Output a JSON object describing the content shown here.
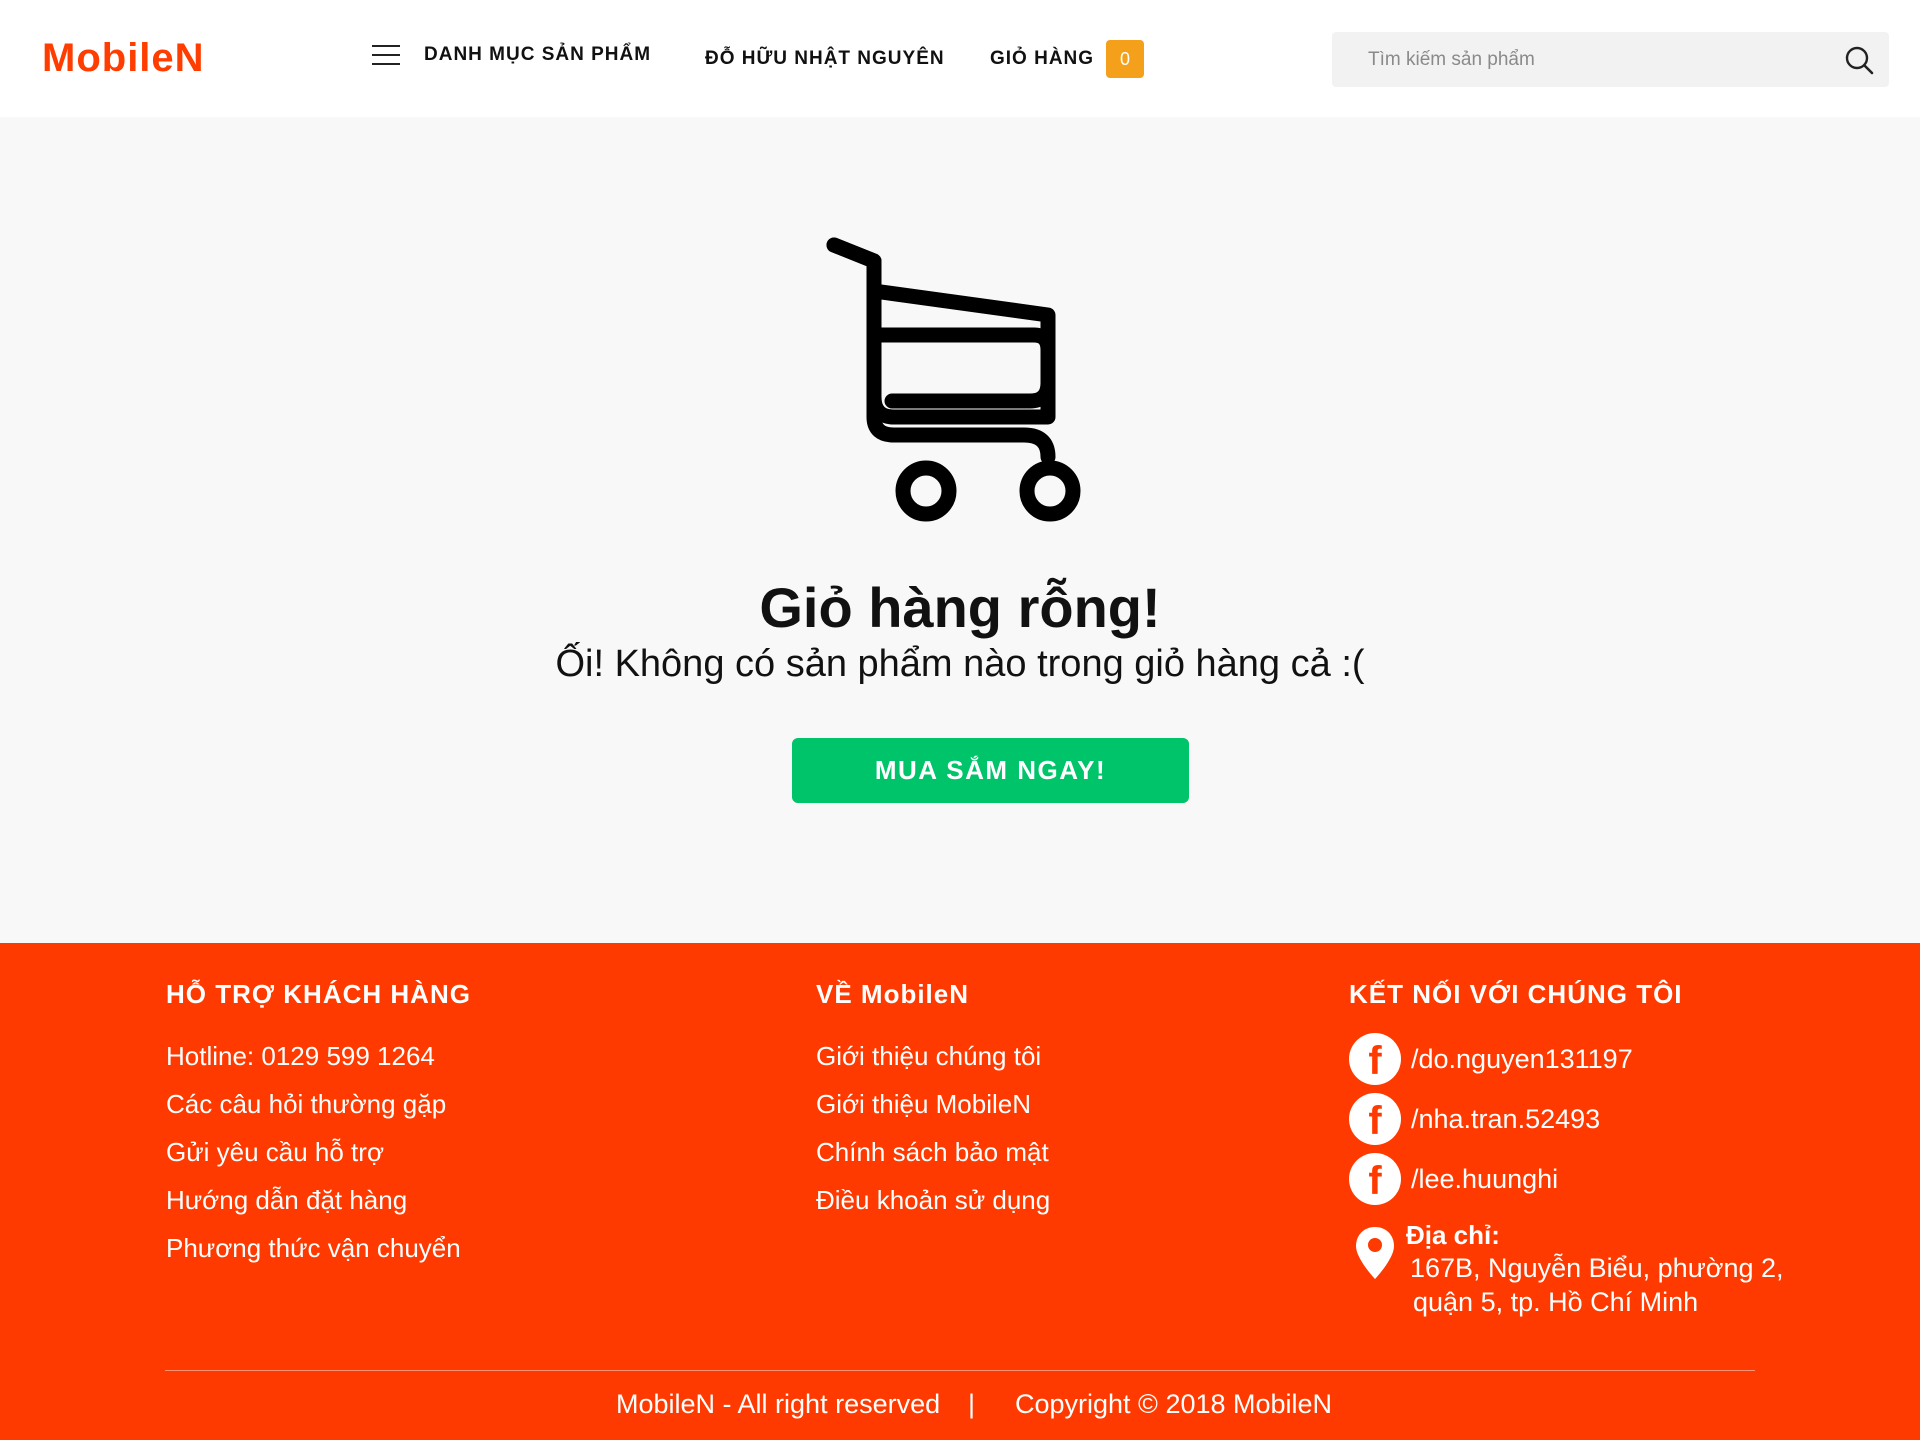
{
  "header": {
    "logo": "MobileN",
    "menu_label": "DANH MỤC SẢN PHẨM",
    "user_name": "ĐỖ HỮU NHẬT NGUYÊN",
    "cart_label": "GIỎ HÀNG",
    "cart_count": "0",
    "search_placeholder": "Tìm kiếm sản phẩm",
    "icons": {
      "menu": "hamburger-icon",
      "search": "search-icon"
    }
  },
  "main": {
    "cart_icon": "shopping-cart-icon",
    "title": "Giỏ hàng rỗng!",
    "subtitle": "Ối! Không có sản phẩm nào trong giỏ hàng cả :(",
    "shop_button": "MUA SẮM NGAY!"
  },
  "footer": {
    "support": {
      "title": "HỖ TRỢ KHÁCH HÀNG",
      "items": [
        "Hotline: 0129 599 1264",
        "Các câu hỏi thường gặp",
        "Gửi yêu cầu hỗ trợ",
        "Hướng dẫn đặt hàng",
        "Phương thức vận chuyển"
      ]
    },
    "about": {
      "title": "VỀ MobileN",
      "items": [
        "Giới thiệu chúng tôi",
        "Giới thiệu MobileN",
        "Chính sách bảo mật",
        "Điều khoản sử dụng"
      ]
    },
    "connect": {
      "title": "KẾT NỐI VỚI CHÚNG TÔI",
      "facebook": [
        "/do.nguyen131197",
        "/nha.tran.52493",
        "/lee.huunghi"
      ],
      "address_label": "Địa chỉ:",
      "address_lines": [
        "167B, Nguyễn Biểu, phường 2,",
        "quận 5, tp. Hồ Chí Minh"
      ]
    },
    "rights": "MobileN - All right reserved",
    "separator": "|",
    "copyright": "Copyright © 2018 MobileN"
  },
  "colors": {
    "brand": "#ff3a00",
    "badge": "#f5a01a",
    "cta": "#00c46a"
  }
}
